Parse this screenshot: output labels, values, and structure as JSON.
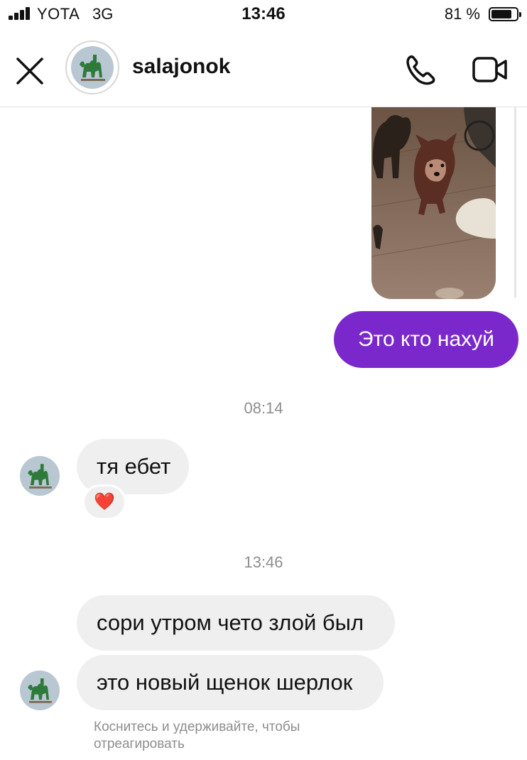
{
  "status_bar": {
    "carrier": "YOTA",
    "network": "3G",
    "time": "13:46",
    "battery": "81 %",
    "battery_level": 0.81
  },
  "header": {
    "username": "salajonok",
    "icons": [
      "close-icon",
      "phone-icon",
      "video-camera-icon"
    ]
  },
  "messages": {
    "outgoing_text": "Это кто нахуй",
    "timestamp_1": "08:14",
    "incoming_1": "тя ебет",
    "reaction": "❤️",
    "timestamp_2": "13:46",
    "incoming_2": "сори утром чето злой был",
    "incoming_3": "это новый щенок шерлок",
    "hint": "Коснитесь и удерживайте, чтобы отреагировать"
  },
  "colors": {
    "outgoing_bubble": "#7a28cc",
    "incoming_bubble": "#efefef",
    "timestamp_text": "#8e8e8e"
  }
}
